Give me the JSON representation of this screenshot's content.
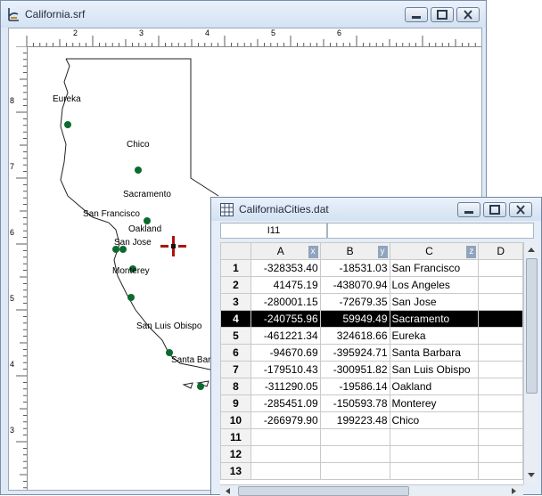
{
  "main_window": {
    "title": "California.srf"
  },
  "h_ruler": {
    "labels": [
      "2",
      "3",
      "4",
      "5",
      "6"
    ]
  },
  "v_ruler": {
    "labels": [
      "8",
      "7",
      "6",
      "5",
      "4",
      "3"
    ]
  },
  "map": {
    "cities": [
      {
        "name": "Eureka",
        "label": "Eureka"
      },
      {
        "name": "Chico",
        "label": "Chico"
      },
      {
        "name": "Sacramento",
        "label": "Sacramento"
      },
      {
        "name": "San Francisco",
        "label": "San Francisco"
      },
      {
        "name": "Oakland",
        "label": "Oakland"
      },
      {
        "name": "San Jose",
        "label": "San Jose"
      },
      {
        "name": "Monterey",
        "label": "Monterey"
      },
      {
        "name": "San Luis Obispo",
        "label": "San Luis Obispo"
      },
      {
        "name": "Santa Barbara",
        "label": "Santa Bar"
      }
    ],
    "point_color": "#0b6b2e"
  },
  "worksheet": {
    "title": "CaliforniaCities.dat",
    "cell_ref": "I11",
    "formula_value": "",
    "columns": [
      {
        "label": "A",
        "tag": "x"
      },
      {
        "label": "B",
        "tag": "y"
      },
      {
        "label": "C",
        "tag": "z"
      },
      {
        "label": "D",
        "tag": ""
      }
    ],
    "rows": [
      {
        "num": "1",
        "a": "-328353.40",
        "b": "-18531.03",
        "c": "San Francisco",
        "d": ""
      },
      {
        "num": "2",
        "a": "41475.19",
        "b": "-438070.94",
        "c": "Los Angeles",
        "d": ""
      },
      {
        "num": "3",
        "a": "-280001.15",
        "b": "-72679.35",
        "c": "San Jose",
        "d": ""
      },
      {
        "num": "4",
        "a": "-240755.96",
        "b": "59949.49",
        "c": "Sacramento",
        "d": ""
      },
      {
        "num": "5",
        "a": "-461221.34",
        "b": "324618.66",
        "c": "Eureka",
        "d": ""
      },
      {
        "num": "6",
        "a": "-94670.69",
        "b": "-395924.71",
        "c": "Santa Barbara",
        "d": ""
      },
      {
        "num": "7",
        "a": "-179510.43",
        "b": "-300951.82",
        "c": "San Luis Obispo",
        "d": ""
      },
      {
        "num": "8",
        "a": "-311290.05",
        "b": "-19586.14",
        "c": "Oakland",
        "d": ""
      },
      {
        "num": "9",
        "a": "-285451.09",
        "b": "-150593.78",
        "c": "Monterey",
        "d": ""
      },
      {
        "num": "10",
        "a": "-266979.90",
        "b": "199223.48",
        "c": "Chico",
        "d": ""
      },
      {
        "num": "11",
        "a": "",
        "b": "",
        "c": "",
        "d": ""
      },
      {
        "num": "12",
        "a": "",
        "b": "",
        "c": "",
        "d": ""
      },
      {
        "num": "13",
        "a": "",
        "b": "",
        "c": "",
        "d": ""
      }
    ],
    "selected_row": "4"
  }
}
